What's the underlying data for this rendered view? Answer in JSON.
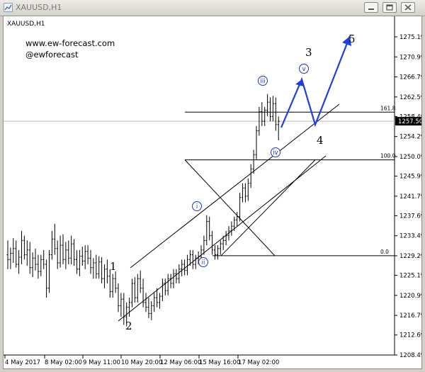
{
  "window": {
    "title": "XAUUSD,H1",
    "buttons": [
      "minimize",
      "restore",
      "close"
    ]
  },
  "chart_data": {
    "type": "candlestick",
    "symbol_label": "XAUUSD,H1",
    "watermark": [
      "www.ew-forecast.com",
      "@ewforecast"
    ],
    "current_price": "1257.50",
    "y_ticks": [
      "1275.19",
      "1270.99",
      "1266.79",
      "1262.59",
      "1258.49",
      "1254.29",
      "1250.09",
      "1245.99",
      "1241.79",
      "1237.69",
      "1233.49",
      "1229.29",
      "1225.19",
      "1220.99",
      "1216.79",
      "1212.69",
      "1208.49"
    ],
    "x_ticks": [
      "4 May 2017",
      "8 May 02:00",
      "9 May 11:00",
      "10 May 20:00",
      "12 May 06:00",
      "15 May 16:00",
      "17 May 02:00"
    ],
    "fib_levels": [
      {
        "label": "161.8",
        "price": 1259.4
      },
      {
        "label": "100.0",
        "price": 1249.4
      },
      {
        "label": "0.0",
        "price": 1229.3
      }
    ],
    "wave_labels": {
      "major": [
        "1",
        "2",
        "3",
        "4",
        "5"
      ],
      "minor": [
        "i",
        "ii",
        "iii",
        "iv",
        "v"
      ]
    },
    "price_range": [
      1208.49,
      1275.19
    ],
    "bars": [
      [
        1229.5,
        1232.5,
        1226.5,
        1228.5
      ],
      [
        1228.5,
        1231,
        1226.5,
        1229.8
      ],
      [
        1229.8,
        1233,
        1227.8,
        1230.8
      ],
      [
        1230.8,
        1232.5,
        1226.8,
        1227.5
      ],
      [
        1227.5,
        1230.5,
        1225.5,
        1229
      ],
      [
        1229,
        1234.5,
        1227.5,
        1232.5
      ],
      [
        1232.5,
        1233.5,
        1228.5,
        1229.5
      ],
      [
        1229.5,
        1232.5,
        1227.2,
        1230.5
      ],
      [
        1230.5,
        1232.2,
        1225.5,
        1226.8
      ],
      [
        1226.8,
        1230,
        1224.8,
        1228.8
      ],
      [
        1228.8,
        1230.8,
        1226.2,
        1227.5
      ],
      [
        1227.5,
        1229.5,
        1224.5,
        1226
      ],
      [
        1226,
        1229.5,
        1225,
        1228.5
      ],
      [
        1228.5,
        1230.5,
        1226.5,
        1227.5
      ],
      [
        1227.5,
        1228.5,
        1220.5,
        1222.5
      ],
      [
        1222.5,
        1230.5,
        1221.5,
        1229.5
      ],
      [
        1229.5,
        1234.5,
        1228.5,
        1232.8
      ],
      [
        1232.8,
        1236,
        1229.5,
        1230.8
      ],
      [
        1230.8,
        1232.5,
        1226.5,
        1227.8
      ],
      [
        1227.8,
        1233.5,
        1226.8,
        1231.5
      ],
      [
        1231.5,
        1233.8,
        1227.5,
        1228.5
      ],
      [
        1228.5,
        1232.2,
        1226.5,
        1230.5
      ],
      [
        1230.5,
        1232.5,
        1227.5,
        1228.8
      ],
      [
        1228.8,
        1233.5,
        1227.5,
        1231.8
      ],
      [
        1231.8,
        1232.8,
        1227.2,
        1228.5
      ],
      [
        1228.5,
        1230.5,
        1225.5,
        1226.5
      ],
      [
        1226.5,
        1230.5,
        1225,
        1229.2
      ],
      [
        1229.2,
        1231.2,
        1227.2,
        1228.2
      ],
      [
        1228.2,
        1231.5,
        1226.5,
        1230.2
      ],
      [
        1230.2,
        1231.5,
        1227.5,
        1228.8
      ],
      [
        1228.8,
        1230.5,
        1225.5,
        1226.8
      ],
      [
        1226.8,
        1228.8,
        1224.5,
        1227.8
      ],
      [
        1227.8,
        1229.5,
        1224.5,
        1225.5
      ],
      [
        1225.5,
        1229.2,
        1224.5,
        1228
      ],
      [
        1228,
        1229,
        1223.5,
        1224.5
      ],
      [
        1224.5,
        1227.5,
        1222.5,
        1226.5
      ],
      [
        1226.5,
        1228.5,
        1223.5,
        1225
      ],
      [
        1225,
        1226.5,
        1220.5,
        1221.8
      ],
      [
        1221.8,
        1225.5,
        1220.5,
        1224.5
      ],
      [
        1224.5,
        1226,
        1221.5,
        1222.5
      ],
      [
        1222.5,
        1223.5,
        1217.5,
        1218.8
      ],
      [
        1218.8,
        1221.5,
        1216.5,
        1220.2
      ],
      [
        1220.2,
        1221.5,
        1214.8,
        1216.5
      ],
      [
        1216.5,
        1219.5,
        1214.5,
        1218.5
      ],
      [
        1218.5,
        1220.5,
        1216.5,
        1219.5
      ],
      [
        1219.5,
        1224.5,
        1218.5,
        1223.5
      ],
      [
        1223.5,
        1224.8,
        1219.5,
        1220.5
      ],
      [
        1220.5,
        1225.5,
        1219.5,
        1224.5
      ],
      [
        1224.5,
        1226.2,
        1221.5,
        1222.5
      ],
      [
        1222.5,
        1224.5,
        1218.5,
        1219.5
      ],
      [
        1219.5,
        1221.5,
        1217.5,
        1218.5
      ],
      [
        1218.5,
        1220.5,
        1216.2,
        1217.2
      ],
      [
        1217.2,
        1219.8,
        1215.8,
        1218.8
      ],
      [
        1218.8,
        1221.5,
        1217.5,
        1220.5
      ],
      [
        1220.5,
        1222.5,
        1218.5,
        1219.5
      ],
      [
        1219.5,
        1221.5,
        1218.2,
        1220.8
      ],
      [
        1220.8,
        1224.5,
        1219.8,
        1223.5
      ],
      [
        1223.5,
        1224.5,
        1221,
        1222
      ],
      [
        1222,
        1225.5,
        1221,
        1224.5
      ],
      [
        1224.5,
        1225.5,
        1222.5,
        1223.5
      ],
      [
        1223.5,
        1226.5,
        1222.5,
        1225.5
      ],
      [
        1225.5,
        1226.5,
        1223.5,
        1224.5
      ],
      [
        1224.5,
        1227.5,
        1223.5,
        1226.5
      ],
      [
        1226.5,
        1228.5,
        1225,
        1227.5
      ],
      [
        1227.5,
        1228.5,
        1225.2,
        1226.2
      ],
      [
        1226.2,
        1229.5,
        1225.2,
        1228.5
      ],
      [
        1228.5,
        1230.5,
        1227.2,
        1229.5
      ],
      [
        1229.5,
        1230.5,
        1226.5,
        1227.5
      ],
      [
        1227.5,
        1229.5,
        1226.5,
        1228.8
      ],
      [
        1228.8,
        1230.2,
        1227.5,
        1229.2
      ],
      [
        1229.2,
        1231.5,
        1228.2,
        1230.5
      ],
      [
        1230.5,
        1233.5,
        1229.5,
        1232.5
      ],
      [
        1232.5,
        1237.8,
        1231.5,
        1236.5
      ],
      [
        1236.5,
        1237.5,
        1232.5,
        1233.5
      ],
      [
        1233.5,
        1234.5,
        1229.5,
        1230.5
      ],
      [
        1230.5,
        1231.5,
        1228.5,
        1229.5
      ],
      [
        1229.5,
        1231.5,
        1228.5,
        1230.8
      ],
      [
        1230.8,
        1232.5,
        1229.5,
        1231.8
      ],
      [
        1231.8,
        1233.5,
        1230.5,
        1232.5
      ],
      [
        1232.5,
        1234.5,
        1231.5,
        1233.5
      ],
      [
        1233.5,
        1235.5,
        1232.5,
        1234.5
      ],
      [
        1234.5,
        1236.5,
        1233.5,
        1235.5
      ],
      [
        1235.5,
        1237.5,
        1234.5,
        1236.8
      ],
      [
        1236.8,
        1238.5,
        1235.5,
        1237.5
      ],
      [
        1237.5,
        1242.5,
        1236.5,
        1241.5
      ],
      [
        1241.5,
        1244.5,
        1240.5,
        1243.5
      ],
      [
        1243.5,
        1244.5,
        1240.5,
        1241.8
      ],
      [
        1241.8,
        1245.5,
        1240.8,
        1244.5
      ],
      [
        1244.5,
        1248.5,
        1243.5,
        1247.5
      ],
      [
        1247.5,
        1251.5,
        1246.5,
        1250.5
      ],
      [
        1250.5,
        1256.5,
        1249.5,
        1255.5
      ],
      [
        1255.5,
        1260.5,
        1254.5,
        1259.5
      ],
      [
        1259.5,
        1261.5,
        1256.5,
        1257.5
      ],
      [
        1257.5,
        1260.5,
        1256.5,
        1259.8
      ],
      [
        1259.8,
        1263.2,
        1258.5,
        1261.5
      ],
      [
        1261.5,
        1262.5,
        1257.5,
        1258.5
      ],
      [
        1258.5,
        1262.8,
        1257.5,
        1261.2
      ],
      [
        1261.2,
        1262.5,
        1255.5,
        1256.8
      ],
      [
        1256.8,
        1258.5,
        1253.5,
        1257.5
      ]
    ]
  }
}
